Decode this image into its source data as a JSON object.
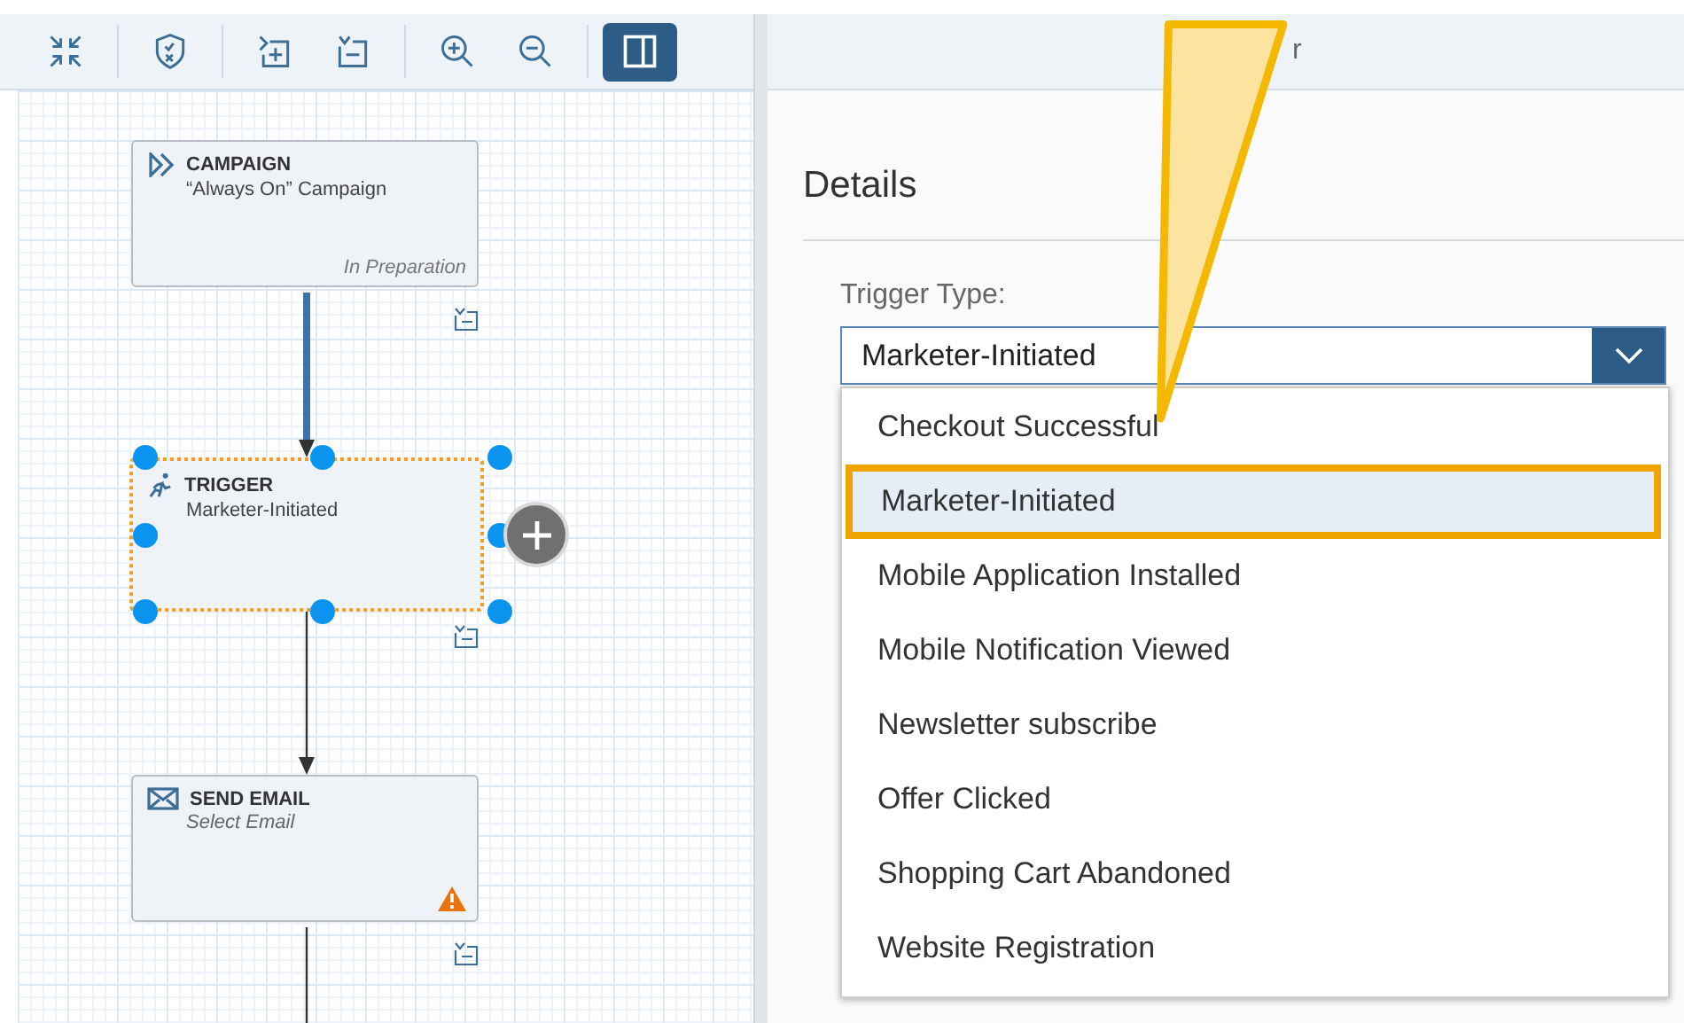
{
  "toolbar": {
    "buttons": [
      {
        "kind": "collapse",
        "selected": false
      },
      {
        "kind": "shield",
        "selected": false
      },
      {
        "kind": "add",
        "selected": false
      },
      {
        "kind": "remove",
        "selected": false
      },
      {
        "kind": "zoom-in",
        "selected": false
      },
      {
        "kind": "zoom-out",
        "selected": false
      },
      {
        "kind": "panel",
        "selected": true
      }
    ]
  },
  "canvas": {
    "nodes": [
      {
        "kind": "campaign",
        "title": "CAMPAIGN",
        "subtitle": "“Always On” Campaign",
        "is_placeholder": false,
        "status": "In Preparation",
        "selected": false,
        "warning": false
      },
      {
        "kind": "trigger",
        "title": "TRIGGER",
        "subtitle": "Marketer-Initiated",
        "is_placeholder": false,
        "selected": true,
        "warning": false
      },
      {
        "kind": "email",
        "title": "SEND EMAIL",
        "subtitle": "Select Email",
        "is_placeholder": true,
        "selected": false,
        "warning": true
      }
    ],
    "connectors": [
      {
        "kind": "active"
      },
      {
        "kind": "plain"
      },
      {
        "kind": "plain"
      }
    ]
  },
  "panel": {
    "title": "r",
    "section": "Details",
    "field": {
      "label": "Trigger Type:",
      "value": "Marketer-Initiated",
      "expanded": true
    },
    "options": [
      {
        "label": "Checkout Successful",
        "selected": false
      },
      {
        "label": "Marketer-Initiated",
        "selected": true
      },
      {
        "label": "Mobile Application Installed",
        "selected": false
      },
      {
        "label": "Mobile Notification Viewed",
        "selected": false
      },
      {
        "label": "Newsletter subscribe",
        "selected": false
      },
      {
        "label": "Offer Clicked",
        "selected": false
      },
      {
        "label": "Shopping Cart Abandoned",
        "selected": false
      },
      {
        "label": "Website Registration",
        "selected": false
      }
    ]
  }
}
